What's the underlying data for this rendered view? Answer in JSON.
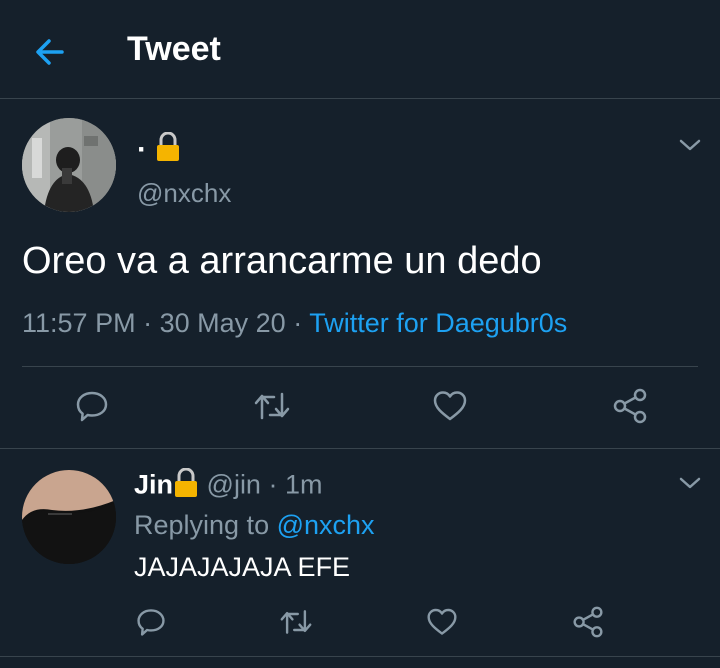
{
  "header": {
    "title": "Tweet"
  },
  "tweet": {
    "display_name": "·",
    "handle": "@nxchx",
    "text": "Oreo va a arrancarme un dedo",
    "time": "11:57 PM",
    "date": "30 May 20",
    "source": "Twitter for Daegubr0s"
  },
  "reply": {
    "display_name": "Jin",
    "handle": "@jin",
    "time": "1m",
    "replying_label": "Replying to",
    "replying_to": "@nxchx",
    "text": "JAJAJAJAJA EFE"
  },
  "colors": {
    "background": "#15202b",
    "accent": "#1da1f2",
    "secondary_text": "#8899a6",
    "divider": "#38444d",
    "lock": "#f5b400"
  },
  "icons": [
    "back-arrow-icon",
    "lock-icon",
    "chevron-down-icon",
    "reply-icon",
    "retweet-icon",
    "like-icon",
    "share-icon"
  ]
}
